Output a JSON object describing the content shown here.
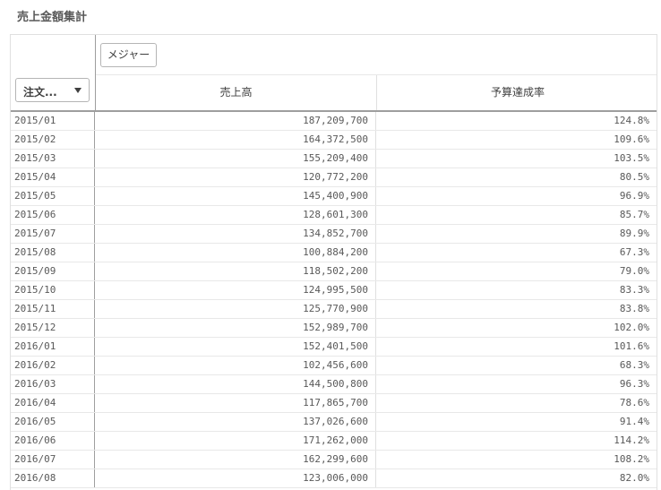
{
  "title": "売上金額集計",
  "table": {
    "dimension_selector_label": "注文...",
    "measure_button_label": "メジャー",
    "columns": {
      "sales": "売上高",
      "budget": "予算達成率"
    },
    "rows": [
      {
        "month": "2015/01",
        "sales": "187,209,700",
        "budget": "124.8%"
      },
      {
        "month": "2015/02",
        "sales": "164,372,500",
        "budget": "109.6%"
      },
      {
        "month": "2015/03",
        "sales": "155,209,400",
        "budget": "103.5%"
      },
      {
        "month": "2015/04",
        "sales": "120,772,200",
        "budget": "80.5%"
      },
      {
        "month": "2015/05",
        "sales": "145,400,900",
        "budget": "96.9%"
      },
      {
        "month": "2015/06",
        "sales": "128,601,300",
        "budget": "85.7%"
      },
      {
        "month": "2015/07",
        "sales": "134,852,700",
        "budget": "89.9%"
      },
      {
        "month": "2015/08",
        "sales": "100,884,200",
        "budget": "67.3%"
      },
      {
        "month": "2015/09",
        "sales": "118,502,200",
        "budget": "79.0%"
      },
      {
        "month": "2015/10",
        "sales": "124,995,500",
        "budget": "83.3%"
      },
      {
        "month": "2015/11",
        "sales": "125,770,900",
        "budget": "83.8%"
      },
      {
        "month": "2015/12",
        "sales": "152,989,700",
        "budget": "102.0%"
      },
      {
        "month": "2016/01",
        "sales": "152,401,500",
        "budget": "101.6%"
      },
      {
        "month": "2016/02",
        "sales": "102,456,600",
        "budget": "68.3%"
      },
      {
        "month": "2016/03",
        "sales": "144,500,800",
        "budget": "96.3%"
      },
      {
        "month": "2016/04",
        "sales": "117,865,700",
        "budget": "78.6%"
      },
      {
        "month": "2016/05",
        "sales": "137,026,600",
        "budget": "91.4%"
      },
      {
        "month": "2016/06",
        "sales": "171,262,000",
        "budget": "114.2%"
      },
      {
        "month": "2016/07",
        "sales": "162,299,600",
        "budget": "108.2%"
      },
      {
        "month": "2016/08",
        "sales": "123,006,000",
        "budget": "82.0%"
      }
    ]
  }
}
